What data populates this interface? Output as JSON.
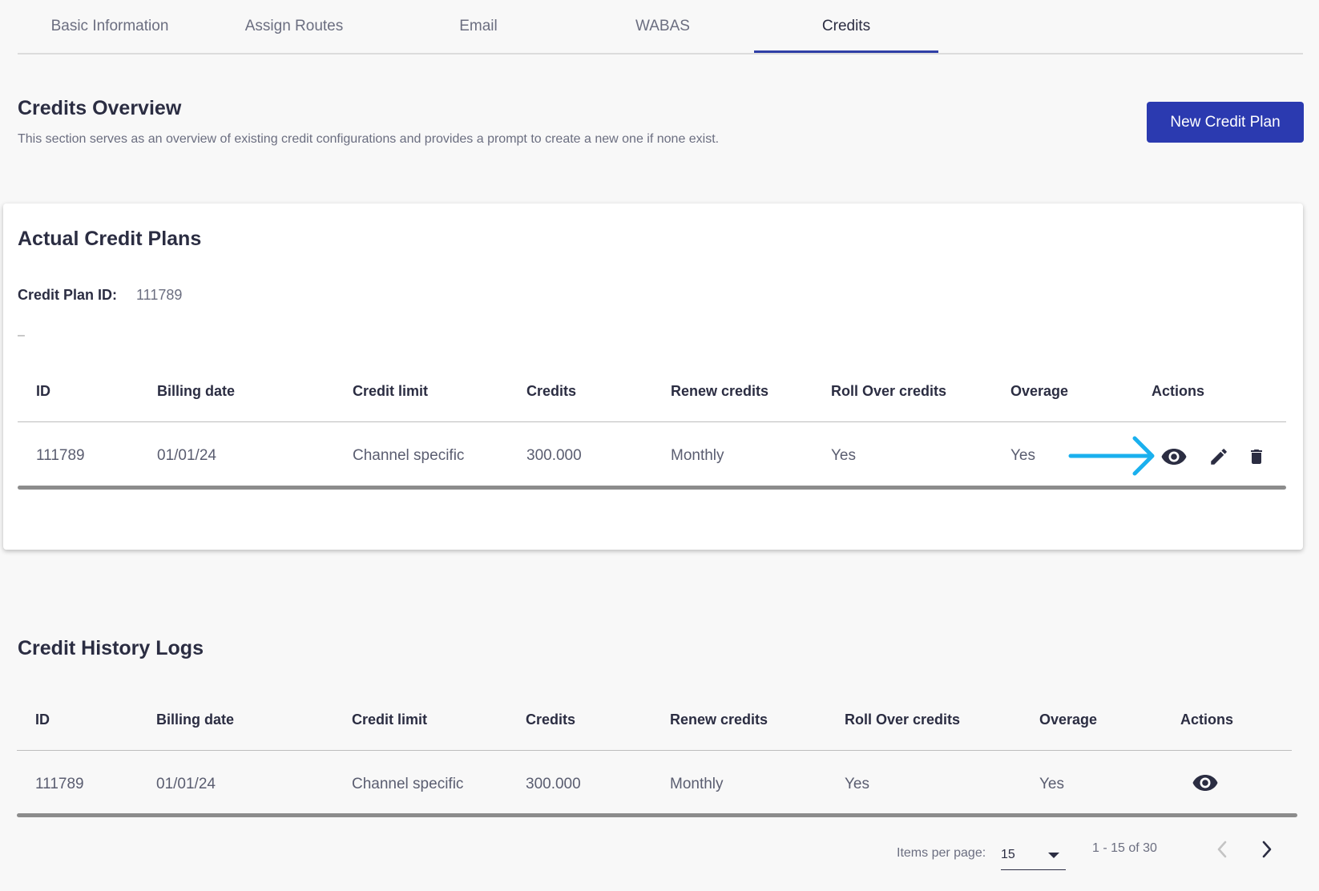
{
  "tabs": [
    {
      "label": "Basic Information"
    },
    {
      "label": "Assign Routes"
    },
    {
      "label": "Email"
    },
    {
      "label": "WABAS"
    },
    {
      "label": "Credits"
    }
  ],
  "active_tab": "Credits",
  "overview": {
    "title": "Credits Overview",
    "description": "This section serves as an overview of existing credit configurations and provides a prompt to create a new one if none exist.",
    "new_button_label": "New Credit Plan"
  },
  "actual_plans": {
    "title": "Actual Credit Plans",
    "plan_id_label": "Credit Plan ID:",
    "plan_id_value": "111789",
    "separator": "–",
    "columns": [
      "ID",
      "Billing date",
      "Credit limit",
      "Credits",
      "Renew credits",
      "Roll Over credits",
      "Overage",
      "Actions"
    ],
    "rows": [
      {
        "id": "111789",
        "billing_date": "01/01/24",
        "credit_limit": "Channel specific",
        "credits": "300.000",
        "renew": "Monthly",
        "rollover": "Yes",
        "overage": "Yes"
      }
    ],
    "action_icons": [
      "eye-icon",
      "pencil-icon",
      "trash-icon"
    ]
  },
  "history": {
    "title": "Credit History Logs",
    "columns": [
      "ID",
      "Billing date",
      "Credit limit",
      "Credits",
      "Renew credits",
      "Roll Over credits",
      "Overage",
      "Actions"
    ],
    "rows": [
      {
        "id": "111789",
        "billing_date": "01/01/24",
        "credit_limit": "Channel specific",
        "credits": "300.000",
        "renew": "Monthly",
        "rollover": "Yes",
        "overage": "Yes"
      }
    ],
    "action_icons": [
      "eye-icon"
    ]
  },
  "paginator": {
    "items_per_page_label": "Items per page:",
    "items_per_page_value": "15",
    "range": "1 - 15 of 30"
  },
  "colors": {
    "accent": "#2b3ab0",
    "annotation_arrow": "#1ab0ee"
  }
}
